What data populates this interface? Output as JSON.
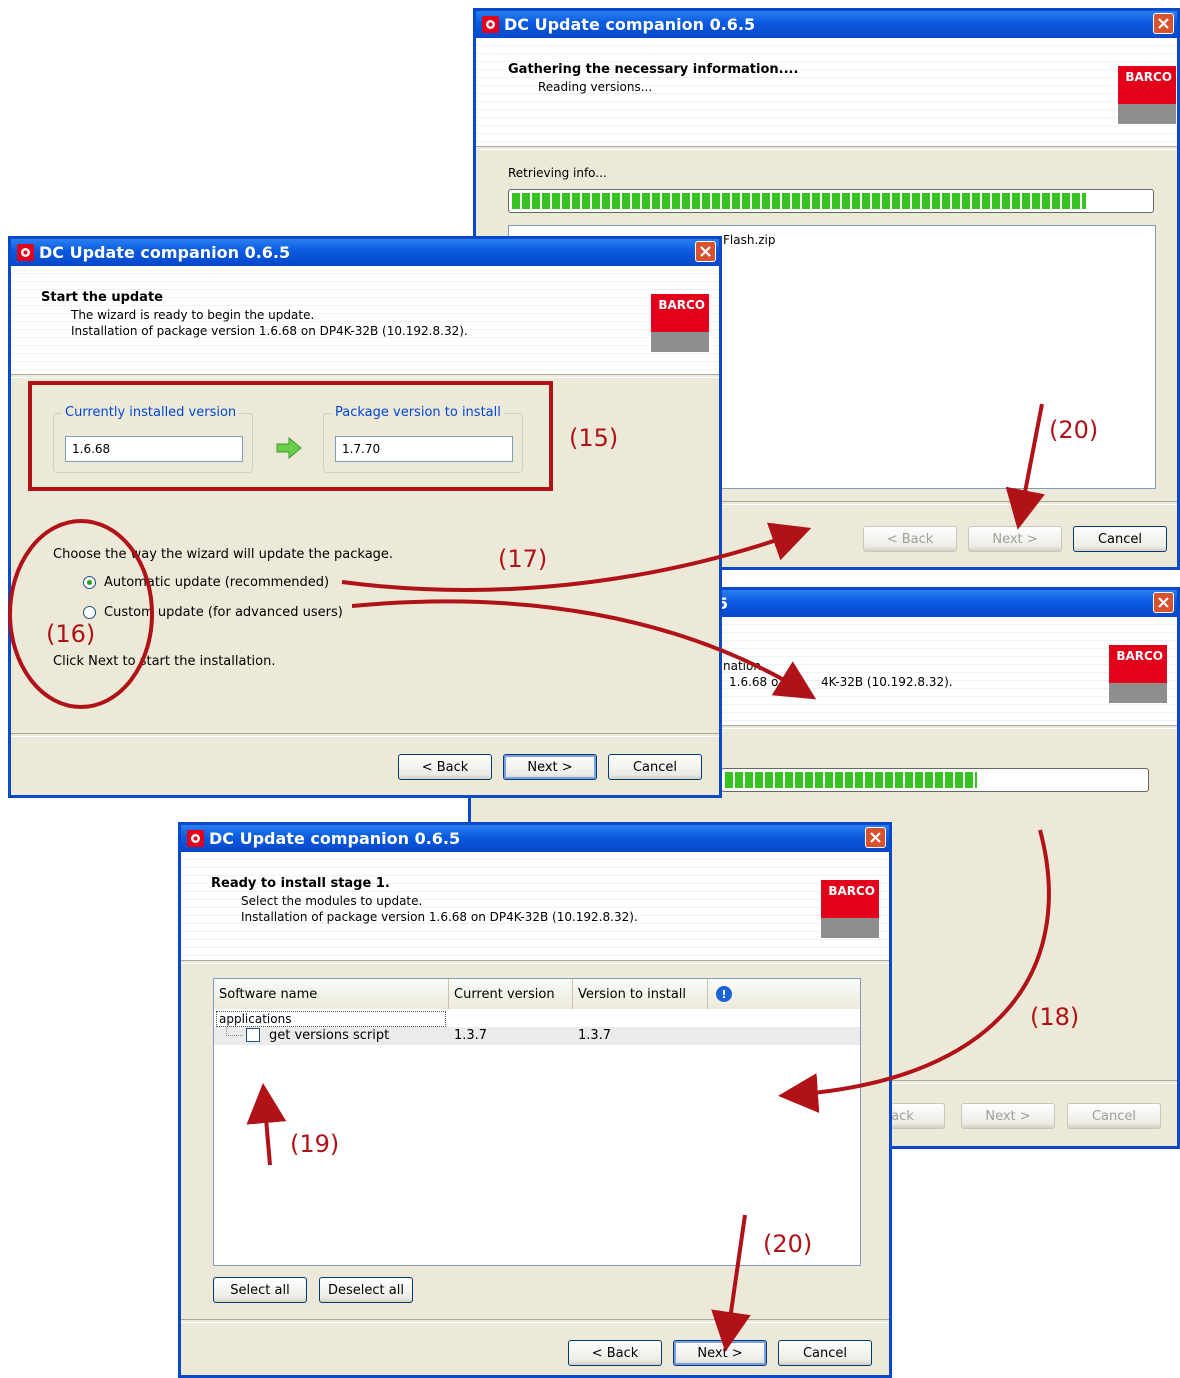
{
  "common": {
    "window_title": "DC Update companion 0.6.5",
    "brand": "BARCO",
    "close_glyph": "✕"
  },
  "win_gather": {
    "header_title": "Gathering the necessary information....",
    "header_line1": "Reading versions...",
    "status": "Retrieving info...",
    "progress": 0.9,
    "log_line_visible": "Flash.zip",
    "back": "< Back",
    "next": "Next >",
    "cancel": "Cancel"
  },
  "win_progress": {
    "header_fragment1": "nation",
    "header_fragment2": "1.6.68 o",
    "header_fragment3": "4K-32B (10.192.8.32).",
    "progress_visible_fill": 0.6,
    "back": "Back",
    "next": "Next >",
    "cancel": "Cancel"
  },
  "win_start": {
    "header_title": "Start the update",
    "header_line1": "The wizard is ready to begin the update.",
    "header_line2": "Installation of package version 1.6.68 on DP4K-32B (10.192.8.32).",
    "current_label": "Currently installed version",
    "current_value": "1.6.68",
    "package_label": "Package version to install",
    "package_value": "1.7.70",
    "choose_text": "Choose the way the wizard will update the package.",
    "option_auto": "Automatic update (recommended)",
    "option_custom": "Custom update (for advanced users)",
    "selected_option": "auto",
    "footer_text": "Click Next to start the installation.",
    "back": "< Back",
    "next": "Next >",
    "cancel": "Cancel"
  },
  "win_ready": {
    "header_title": "Ready to install stage 1.",
    "header_line1": "Select the modules to update.",
    "header_line2": "Installation of package version 1.6.68 on DP4K-32B (10.192.8.32).",
    "columns": [
      "Software name",
      "Current version",
      "Version to install"
    ],
    "info_glyph": "!",
    "group": "applications",
    "rows": [
      {
        "name": "get versions script",
        "current": "1.3.7",
        "install": "1.3.7",
        "checked": false
      }
    ],
    "select_all": "Select all",
    "deselect_all": "Deselect all",
    "back": "< Back",
    "next": "Next >",
    "cancel": "Cancel"
  },
  "annotations": {
    "a15": "(15)",
    "a16": "(16)",
    "a17": "(17)",
    "a18": "(18)",
    "a19": "(19)",
    "a20a": "(20)",
    "a20b": "(20)"
  },
  "colors": {
    "annotation": "#b01217",
    "titlebar": "#0a5ae0",
    "progress": "#37c322",
    "window_bg": "#ece9d8"
  }
}
